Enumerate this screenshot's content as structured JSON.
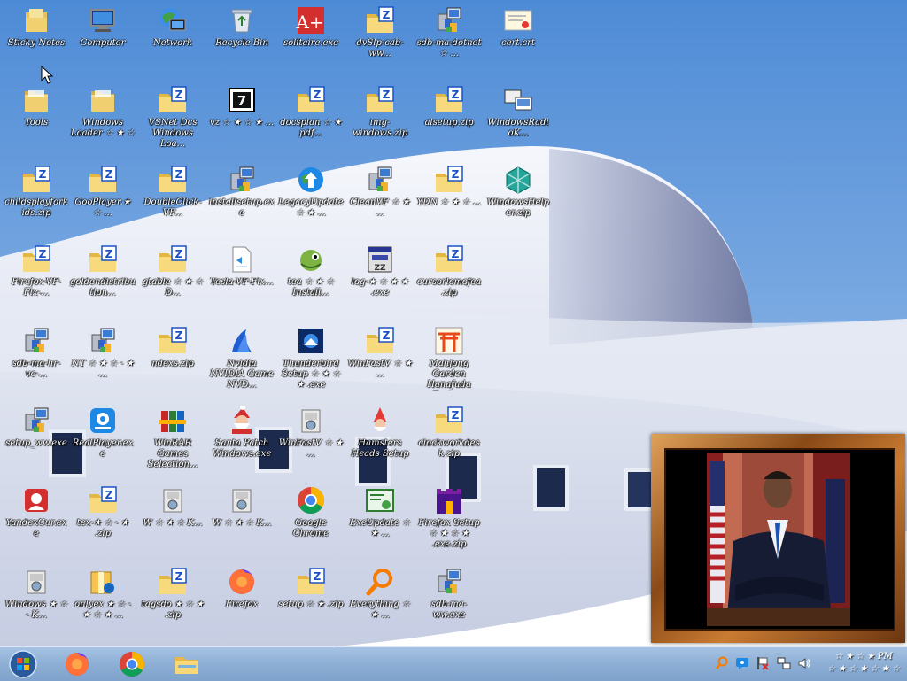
{
  "desktop": {
    "icons": [
      {
        "label": "Sticky Notes",
        "icon": "sticky-folder-icon"
      },
      {
        "label": "Tools",
        "icon": "folder-icon"
      },
      {
        "label": "childsplayforkids.zip",
        "icon": "zip-folder-icon"
      },
      {
        "label": "Firefox-VF-Fix-...",
        "icon": "zip-folder-icon"
      },
      {
        "label": "sdb-ma-hr-vc-...",
        "icon": "installer-icon"
      },
      {
        "label": "setup_ww.exe",
        "icon": "installer-icon"
      },
      {
        "label": "YandexCur.exe",
        "icon": "red-app-icon"
      },
      {
        "label": "Windows ★ ☆ - K...",
        "icon": "cabinet-icon"
      },
      {
        "label": "Computer",
        "icon": "computer-icon"
      },
      {
        "label": "Windows Loader ☆ ★ ☆",
        "icon": "folder-icon"
      },
      {
        "label": "GooPlayer.★ ☆ ...",
        "icon": "zip-folder-icon"
      },
      {
        "label": "goldendistribution...",
        "icon": "zip-folder-icon"
      },
      {
        "label": "NT ☆ ★ ☆ - ★ ...",
        "icon": "installer-icon"
      },
      {
        "label": "RealPlayer.exe",
        "icon": "blue-app-icon"
      },
      {
        "label": "tex-★ ☆ - ★ .zip",
        "icon": "zip-folder-icon"
      },
      {
        "label": "onlyex ★ ☆ - ★ ☆ ★ ...",
        "icon": "archive-icon"
      },
      {
        "label": "Network",
        "icon": "network-icon"
      },
      {
        "label": "VSNet Dcs Windows Loa...",
        "icon": "zip-folder-icon"
      },
      {
        "label": "DoubleClick-VF...",
        "icon": "zip-folder-icon"
      },
      {
        "label": "gtable ☆ ★ ☆ D...",
        "icon": "zip-folder-icon"
      },
      {
        "label": "ndexs.zip",
        "icon": "zip-folder-icon"
      },
      {
        "label": "WinRAR Games Selection...",
        "icon": "winrar-icon"
      },
      {
        "label": "W ☆ ★ ☆ K...",
        "icon": "cabinet-icon"
      },
      {
        "label": "tagsdo ★ ☆ ★ .zip",
        "icon": "zip-folder-icon"
      },
      {
        "label": "Recycle Bin",
        "icon": "recycle-bin-icon"
      },
      {
        "label": "vz ☆ ★ ☆ ★ ...",
        "icon": "seven-zip-icon"
      },
      {
        "label": "installsetup.exe",
        "icon": "installer-icon"
      },
      {
        "label": "Tesla-VF-Fix...",
        "icon": "document-icon"
      },
      {
        "label": "Nvidia NVIDIA Game NVD...",
        "icon": "blue-wave-icon"
      },
      {
        "label": "Santa Patch Windows.exe",
        "icon": "santa-icon"
      },
      {
        "label": "W ☆ ★ ☆ K...",
        "icon": "cabinet-icon"
      },
      {
        "label": "Firefox",
        "icon": "firefox-icon"
      },
      {
        "label": "solitaire.exe",
        "icon": "red-a-plus-icon"
      },
      {
        "label": "docsplan ☆ ★ pdf...",
        "icon": "zip-folder-icon"
      },
      {
        "label": "LegacyUpdate ☆ ★ ...",
        "icon": "globe-update-icon"
      },
      {
        "label": "tea ☆ ★ ☆ Install...",
        "icon": "chameleon-icon"
      },
      {
        "label": "Thunderbird Setup ☆ ★ ☆ ★ .exe",
        "icon": "thunderbird-icon"
      },
      {
        "label": "WinFastV ☆ ★ ...",
        "icon": "cabinet-icon"
      },
      {
        "label": "Google Chrome",
        "icon": "chrome-icon"
      },
      {
        "label": "setup ☆ ★ .zip",
        "icon": "zip-folder-icon"
      },
      {
        "label": "dvSlp-cab-ww...",
        "icon": "zip-folder-icon"
      },
      {
        "label": "img-windows.zip",
        "icon": "zip-folder-icon"
      },
      {
        "label": "CleanVF ☆ ★ ...",
        "icon": "installer-icon"
      },
      {
        "label": "log-★ ☆ ★ ★ .exe",
        "icon": "zz-app-icon"
      },
      {
        "label": "WinFastV ☆ ★ ...",
        "icon": "zip-folder-icon"
      },
      {
        "label": "Hamsters Heads Setup",
        "icon": "gnome-icon"
      },
      {
        "label": "ExeUpdate ☆ ★ ...",
        "icon": "certificate-app-icon"
      },
      {
        "label": "Everything ☆ ★ ...",
        "icon": "magnifier-icon"
      },
      {
        "label": "sdb-ma-dotnet ☆ ...",
        "icon": "installer-icon"
      },
      {
        "label": "alsetup.zip",
        "icon": "zip-folder-icon"
      },
      {
        "label": "YDN ☆ ★ ☆ ...",
        "icon": "zip-folder-icon"
      },
      {
        "label": "cursorlcmcfea.zip",
        "icon": "zip-folder-icon"
      },
      {
        "label": "Mahjong Garden Hanafuda Trainer",
        "icon": "torii-icon"
      },
      {
        "label": "clockworkdesk.zip",
        "icon": "zip-folder-icon"
      },
      {
        "label": "Firefox Setup ☆ ★ ☆ ★ .exe.zip",
        "icon": "castle-icon"
      },
      {
        "label": "sdb-ma-ww.exe",
        "icon": "installer-icon"
      },
      {
        "label": "cert.crt",
        "icon": "certificate-icon"
      },
      {
        "label": "WindowsRadioK...",
        "icon": "network-app-icon"
      },
      {
        "label": "WindowsHelper.zip",
        "icon": "cube-icon"
      }
    ]
  },
  "taskbar": {
    "pinned": [
      {
        "name": "start-button",
        "icon": "windows-orb-icon"
      },
      {
        "name": "firefox",
        "icon": "firefox-icon"
      },
      {
        "name": "chrome",
        "icon": "chrome-icon"
      },
      {
        "name": "file-explorer",
        "icon": "folder-icon"
      }
    ],
    "tray": [
      "magnifier-icon",
      "chat-icon",
      "flag-icon",
      "network-icon",
      "speaker-icon"
    ],
    "clock_time": "☆ ★ ☆ ★ PM",
    "clock_date": "☆ ★ ☆ ★ ☆ ★ ☆"
  },
  "colors": {
    "sky": "#6fa3dd",
    "building": "#e9edf6",
    "taskbar": "#8fb0d6",
    "frame": "#a8601f"
  }
}
